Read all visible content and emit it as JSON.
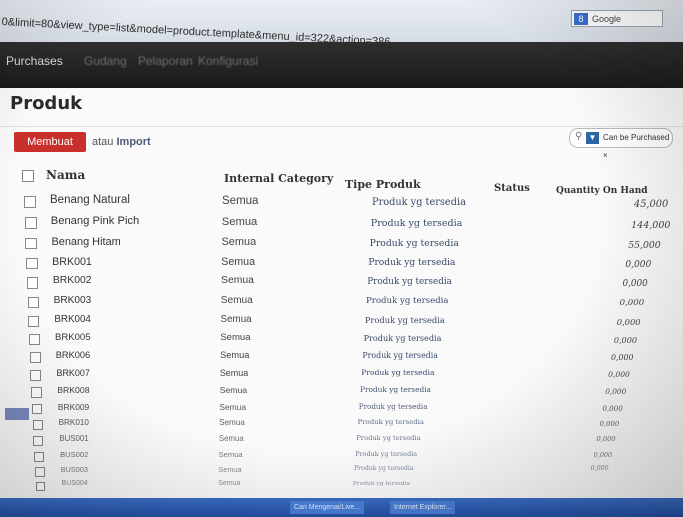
{
  "browser": {
    "url": "0&limit=80&view_type=list&model=product.template&menu_id=322&action=386",
    "search_engine": "Google",
    "g_icon": "8"
  },
  "menu": {
    "items": [
      "Purchases",
      "Gudang",
      "Pelaporan",
      "Konfigurasi"
    ]
  },
  "page": {
    "title": "Produk",
    "create_label": "Membuat",
    "or_label": "atau",
    "import_label": "Import"
  },
  "filter": {
    "text": "Can be Purchased ×"
  },
  "table": {
    "columns": {
      "name": "Nama",
      "category": "Internal Category",
      "type": "Tipe Produk",
      "status": "Status",
      "qty": "Quantity On Hand"
    },
    "rows": [
      {
        "name": "Benang Natural",
        "category": "Semua",
        "type": "Produk yg tersedia",
        "qty": "45,000"
      },
      {
        "name": "Benang Pink Pich",
        "category": "Semua",
        "type": "Produk yg tersedia",
        "qty": "144,000"
      },
      {
        "name": "Benang Hitam",
        "category": "Semua",
        "type": "Produk yg tersedia",
        "qty": "55,000"
      },
      {
        "name": "BRK001",
        "category": "Semua",
        "type": "Produk yg tersedia",
        "qty": "0,000"
      },
      {
        "name": "BRK002",
        "category": "Semua",
        "type": "Produk yg tersedia",
        "qty": "0,000"
      },
      {
        "name": "BRK003",
        "category": "Semua",
        "type": "Produk yg tersedia",
        "qty": "0,000"
      },
      {
        "name": "BRK004",
        "category": "Semua",
        "type": "Produk yg tersedia",
        "qty": "0,000"
      },
      {
        "name": "BRK005",
        "category": "Semua",
        "type": "Produk yg tersedia",
        "qty": "0,000"
      },
      {
        "name": "BRK006",
        "category": "Semua",
        "type": "Produk yg tersedia",
        "qty": "0,000"
      },
      {
        "name": "BRK007",
        "category": "Semua",
        "type": "Produk yg tersedia",
        "qty": "0,000"
      },
      {
        "name": "BRK008",
        "category": "Semua",
        "type": "Produk yg tersedia",
        "qty": "0,000"
      },
      {
        "name": "BRK009",
        "category": "Semua",
        "type": "Produk yg tersedia",
        "qty": "0,000"
      },
      {
        "name": "BRK010",
        "category": "Semua",
        "type": "Produk yg tersedia",
        "qty": "0,000"
      },
      {
        "name": "BUS001",
        "category": "Semua",
        "type": "Produk yg tersedia",
        "qty": "0,000"
      },
      {
        "name": "BUS002",
        "category": "Semua",
        "type": "Produk yg tersedia",
        "qty": "0,000"
      },
      {
        "name": "BUS003",
        "category": "Semua",
        "type": "Produk yg tersedia",
        "qty": "0,000"
      },
      {
        "name": "BUS004",
        "category": "Semua",
        "type": "Produk yg tersedia",
        "qty": ""
      }
    ]
  },
  "taskbar": {
    "items": [
      "Cari Mengenai/Live...",
      "Internet Explorer..."
    ]
  }
}
